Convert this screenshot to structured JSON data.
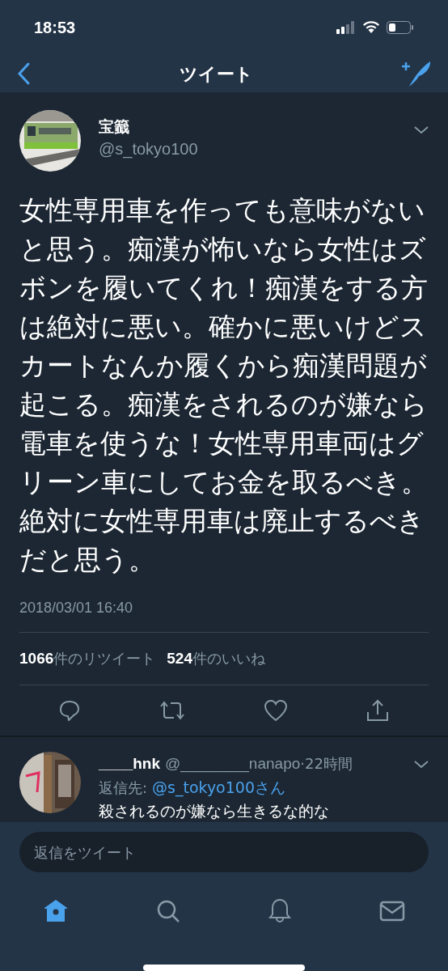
{
  "status_bar": {
    "time": "18:53"
  },
  "nav": {
    "title": "ツイート"
  },
  "tweet": {
    "name": "宝籖",
    "handle": "@s_tokyo100",
    "text": "女性専用車を作っても意味がないと思う。痴漢が怖いなら女性はズボンを履いてくれ！痴漢をする方は絶対に悪い。確かに悪いけどスカートなんか履くから痴漢問題が起こる。痴漢をされるのが嫌なら電車を使うな！女性専用車両はグリーン車にしてお金を取るべき。絶対に女性専用車は廃止するべきだと思う。",
    "timestamp": "2018/03/01 16:40",
    "stats": [
      {
        "count": "1066",
        "label": "件のリツイート"
      },
      {
        "count": "524",
        "label": "件のいいね"
      }
    ]
  },
  "reply": {
    "name": "____hnk",
    "handle": "@________nanapo",
    "time": "·22時間",
    "reply_to": "返信先:",
    "mention": "@s_tokyo100さん",
    "text": "殺されるのが嫌なら生きるな的な"
  },
  "composer": {
    "placeholder": "返信をツイート"
  },
  "tabs": [
    {
      "kind": "home",
      "selected": true
    },
    {
      "kind": "search",
      "selected": false
    },
    {
      "kind": "notifications",
      "selected": false
    },
    {
      "kind": "messages",
      "selected": false
    }
  ]
}
